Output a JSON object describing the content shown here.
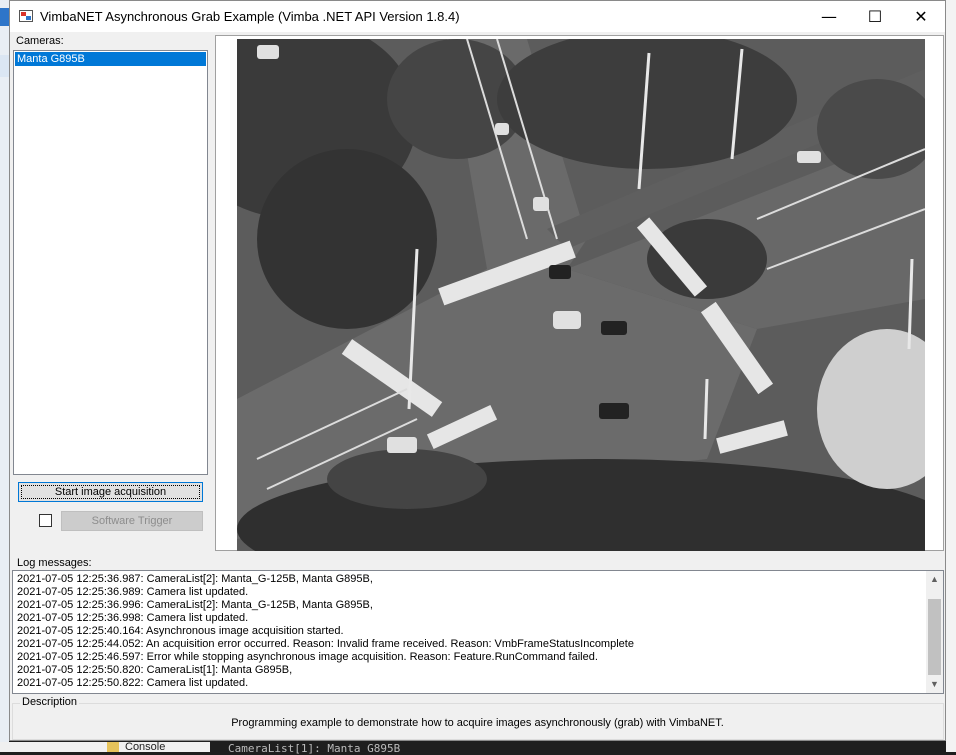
{
  "window": {
    "title": "VimbaNET Asynchronous Grab Example (Vimba .NET API Version 1.8.4)",
    "minimize_glyph": "—",
    "maximize_glyph": "☐",
    "close_glyph": "✕"
  },
  "cameras": {
    "label": "Cameras:",
    "items": [
      "Manta G895B"
    ],
    "selected": "Manta G895B"
  },
  "controls": {
    "start_button": "Start image acquisition",
    "software_trigger": "Software Trigger",
    "software_trigger_checked": false
  },
  "image_view": {
    "description": "grayscale camera frame of a road intersection"
  },
  "log": {
    "label": "Log messages:",
    "lines": [
      "2021-07-05 12:25:36.987: CameraList[2]: Manta_G-125B, Manta G895B,",
      "2021-07-05 12:25:36.989: Camera list updated.",
      "2021-07-05 12:25:36.996: CameraList[2]: Manta_G-125B, Manta G895B,",
      "2021-07-05 12:25:36.998: Camera list updated.",
      "2021-07-05 12:25:40.164: Asynchronous image acquisition started.",
      "2021-07-05 12:25:44.052: An acquisition error occurred. Reason: Invalid frame received. Reason: VmbFrameStatusIncomplete",
      "2021-07-05 12:25:46.597: Error while stopping asynchronous image acquisition. Reason: Feature.RunCommand failed.",
      "2021-07-05 12:25:50.820: CameraList[1]: Manta G895B,",
      "2021-07-05 12:25:50.822: Camera list updated."
    ]
  },
  "description": {
    "label": "Description",
    "text": "Programming example to demonstrate how to acquire images asynchronously (grab) with VimbaNET."
  },
  "background": {
    "console_label": "Console",
    "code_text": "CameraList[1]: Manta G895B"
  }
}
